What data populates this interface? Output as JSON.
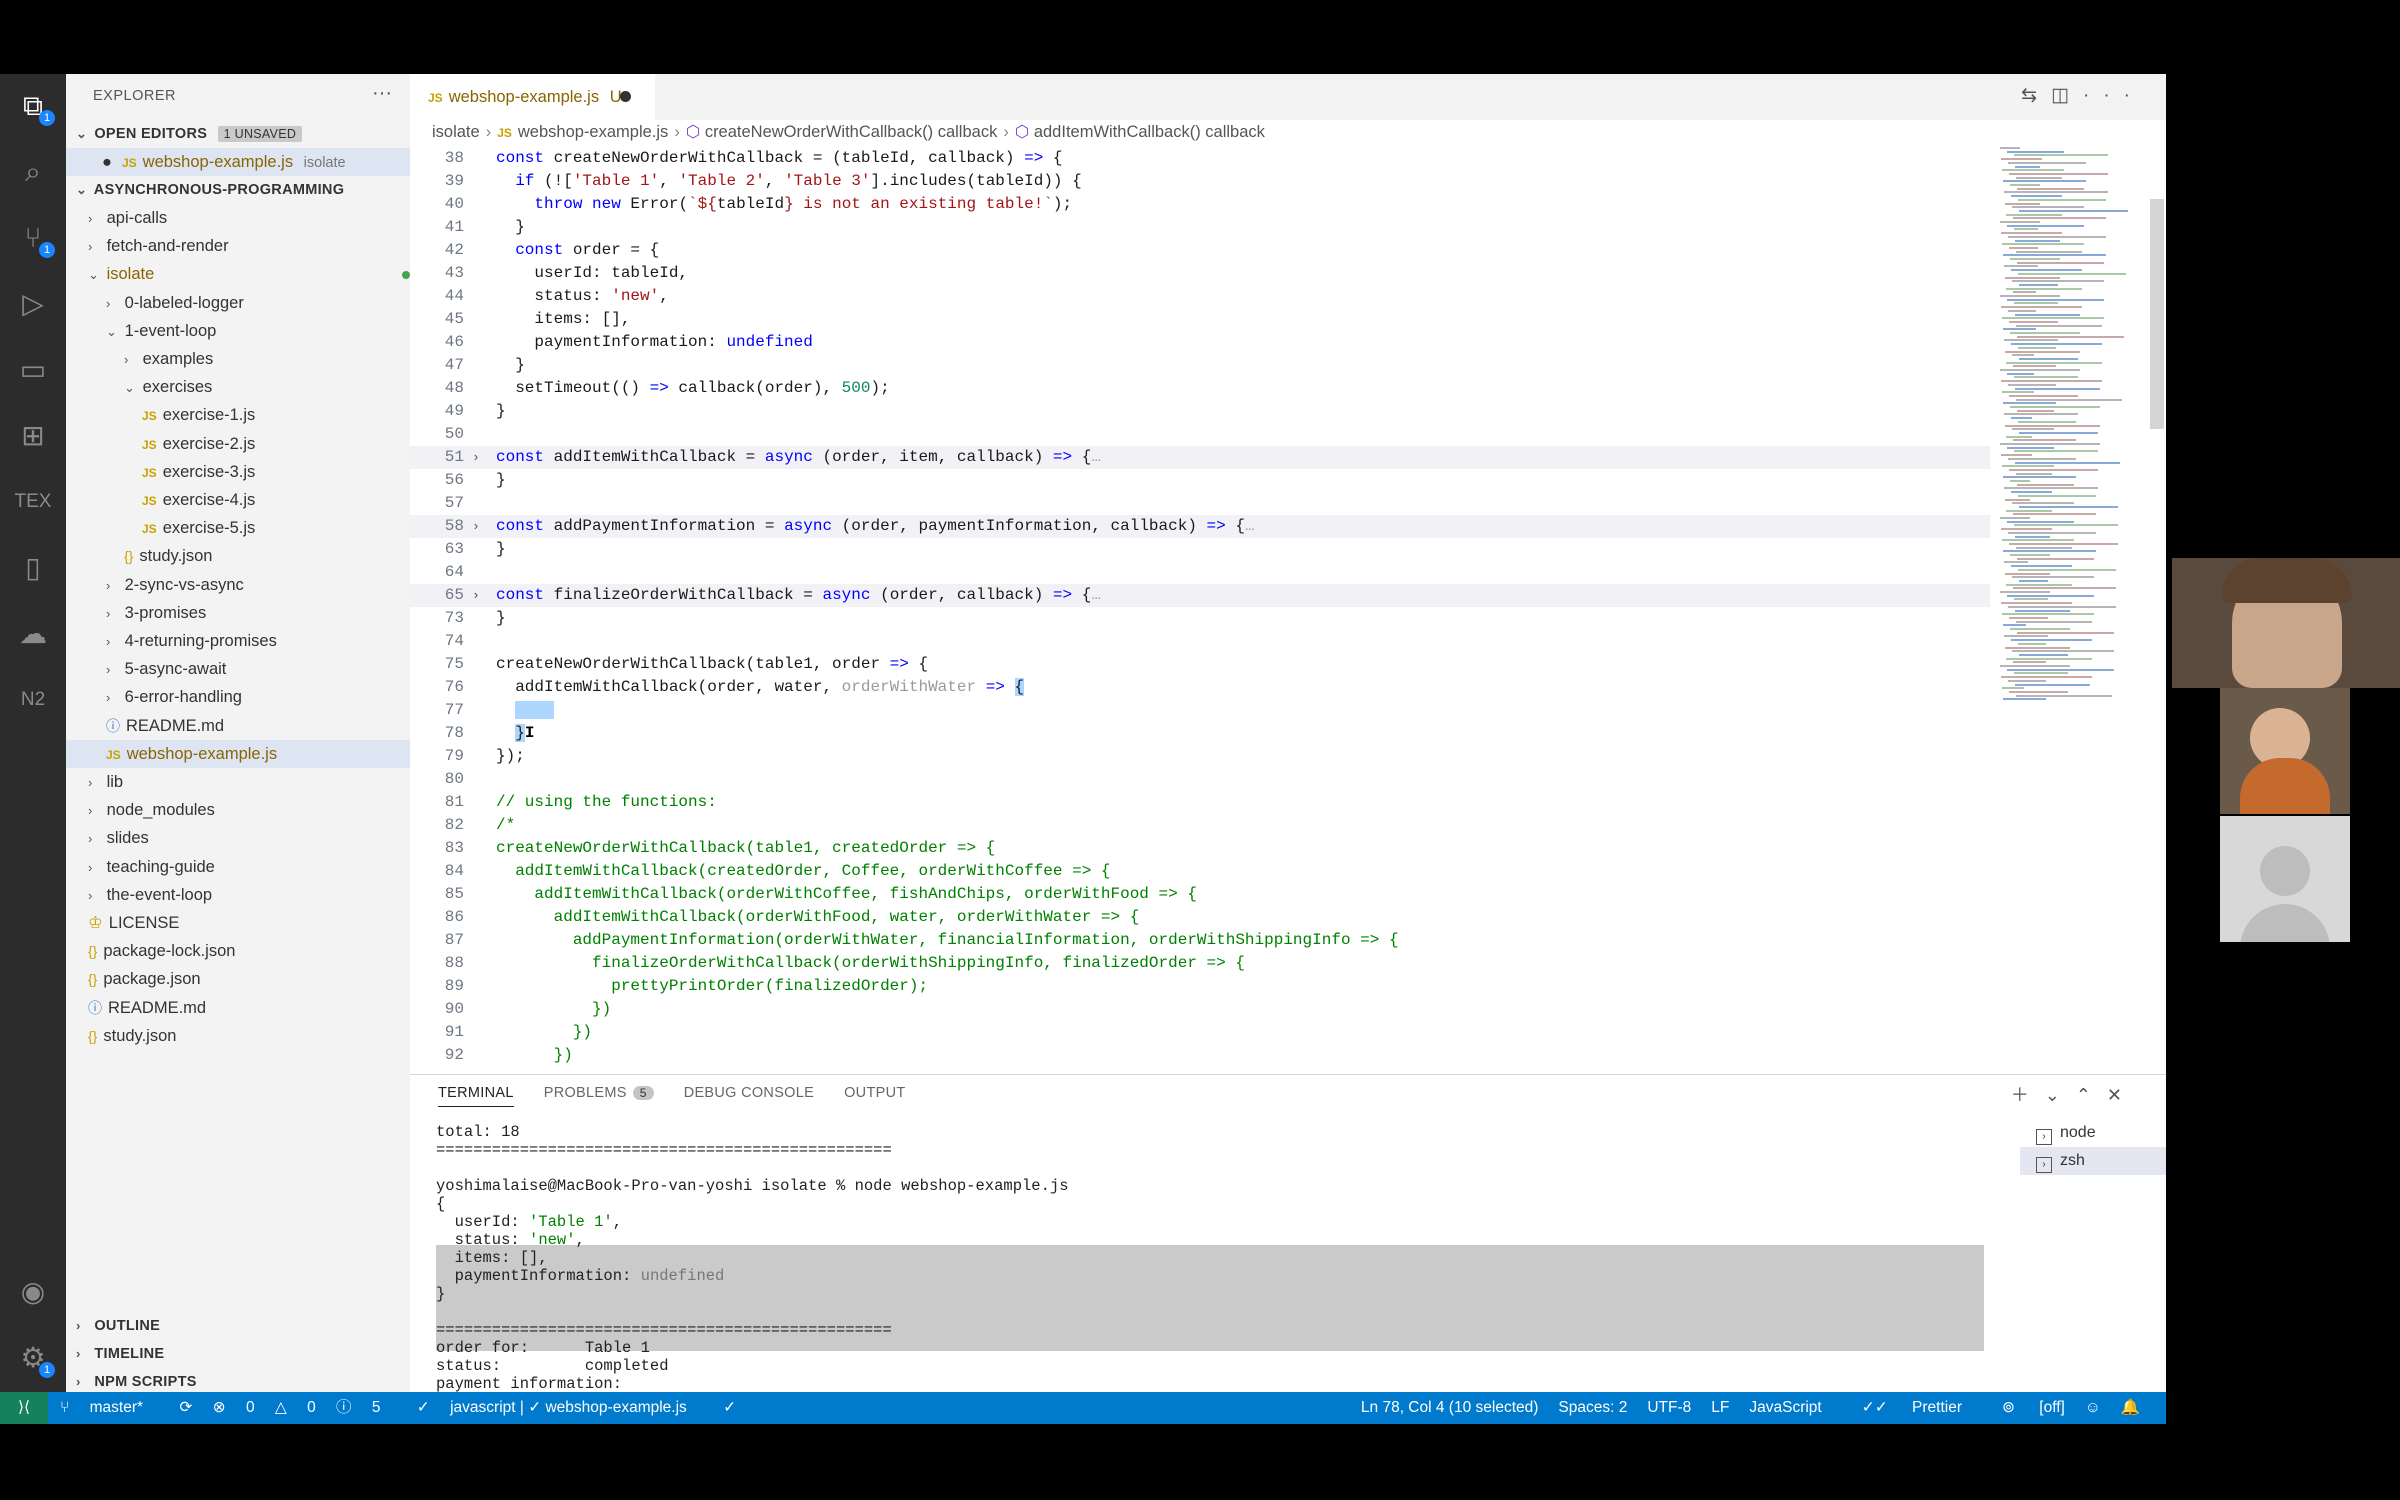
{
  "activity_bar": {
    "icons": [
      "explorer-icon",
      "search-icon",
      "source-control-icon",
      "run-debug-icon",
      "remote-explorer-icon",
      "extensions-icon",
      "tex-icon",
      "bookmark-icon",
      "docker-icon",
      "n2-icon",
      "account-icon",
      "gear-icon"
    ],
    "source_control_badge": "1",
    "explorer_badge": "1",
    "gear_badge": "1",
    "tex_label": "TEX",
    "n2_label": "N2"
  },
  "sidebar": {
    "title": "EXPLORER",
    "open_editors_label": "OPEN EDITORS",
    "unsaved_badge": "1 UNSAVED",
    "open_editor_file": "webshop-example.js",
    "open_editor_folder": "isolate",
    "open_editor_status": "U",
    "project_name": "ASYNCHRONOUS-PROGRAMMING",
    "tree": [
      {
        "label": "api-calls",
        "type": "folder",
        "open": false,
        "indent": 0
      },
      {
        "label": "fetch-and-render",
        "type": "folder",
        "open": false,
        "indent": 0
      },
      {
        "label": "isolate",
        "type": "folder",
        "open": true,
        "indent": 0,
        "modified": true
      },
      {
        "label": "0-labeled-logger",
        "type": "folder",
        "open": false,
        "indent": 1
      },
      {
        "label": "1-event-loop",
        "type": "folder",
        "open": true,
        "indent": 1
      },
      {
        "label": "examples",
        "type": "folder",
        "open": false,
        "indent": 2
      },
      {
        "label": "exercises",
        "type": "folder",
        "open": true,
        "indent": 2
      },
      {
        "label": "exercise-1.js",
        "type": "js",
        "indent": 3
      },
      {
        "label": "exercise-2.js",
        "type": "js",
        "indent": 3
      },
      {
        "label": "exercise-3.js",
        "type": "js",
        "indent": 3
      },
      {
        "label": "exercise-4.js",
        "type": "js",
        "indent": 3
      },
      {
        "label": "exercise-5.js",
        "type": "js",
        "indent": 3
      },
      {
        "label": "study.json",
        "type": "json",
        "indent": 2
      },
      {
        "label": "2-sync-vs-async",
        "type": "folder",
        "open": false,
        "indent": 1
      },
      {
        "label": "3-promises",
        "type": "folder",
        "open": false,
        "indent": 1
      },
      {
        "label": "4-returning-promises",
        "type": "folder",
        "open": false,
        "indent": 1
      },
      {
        "label": "5-async-await",
        "type": "folder",
        "open": false,
        "indent": 1
      },
      {
        "label": "6-error-handling",
        "type": "folder",
        "open": false,
        "indent": 1
      },
      {
        "label": "README.md",
        "type": "info",
        "indent": 1
      },
      {
        "label": "webshop-example.js",
        "type": "js",
        "indent": 1,
        "selected": true,
        "status": "U"
      },
      {
        "label": "lib",
        "type": "folder",
        "open": false,
        "indent": 0
      },
      {
        "label": "node_modules",
        "type": "folder",
        "open": false,
        "indent": 0
      },
      {
        "label": "slides",
        "type": "folder",
        "open": false,
        "indent": 0
      },
      {
        "label": "teaching-guide",
        "type": "folder",
        "open": false,
        "indent": 0
      },
      {
        "label": "the-event-loop",
        "type": "folder",
        "open": false,
        "indent": 0
      },
      {
        "label": "LICENSE",
        "type": "license",
        "indent": 0
      },
      {
        "label": "package-lock.json",
        "type": "json",
        "indent": 0
      },
      {
        "label": "package.json",
        "type": "json",
        "indent": 0
      },
      {
        "label": "README.md",
        "type": "info",
        "indent": 0
      },
      {
        "label": "study.json",
        "type": "json",
        "indent": 0
      }
    ],
    "outline_label": "OUTLINE",
    "timeline_label": "TIMELINE",
    "npm_scripts_label": "NPM SCRIPTS"
  },
  "editor": {
    "tab_label": "webshop-example.js",
    "tab_status": "U",
    "breadcrumb": [
      "isolate",
      "webshop-example.js",
      "createNewOrderWithCallback() callback",
      "addItemWithCallback() callback"
    ],
    "lines": [
      {
        "n": "38",
        "html": "<span class=\"kw\">const</span> createNewOrderWithCallback = (tableId, callback) <span class=\"kw\">=&gt;</span> {"
      },
      {
        "n": "39",
        "html": "  <span class=\"kw\">if</span> (![<span class=\"st\">'Table 1'</span>, <span class=\"st\">'Table 2'</span>, <span class=\"st\">'Table 3'</span>].includes(tableId)) {"
      },
      {
        "n": "40",
        "html": "    <span class=\"kw\">throw new</span> Error(<span class=\"st\">`${</span>tableId<span class=\"st\">} is not an existing table!`</span>);"
      },
      {
        "n": "41",
        "html": "  }"
      },
      {
        "n": "42",
        "html": "  <span class=\"kw\">const</span> order = {"
      },
      {
        "n": "43",
        "html": "    userId: tableId,"
      },
      {
        "n": "44",
        "html": "    status: <span class=\"st\">'new'</span>,"
      },
      {
        "n": "45",
        "html": "    items: [],"
      },
      {
        "n": "46",
        "html": "    paymentInformation: <span class=\"kw\">undefined</span>"
      },
      {
        "n": "47",
        "html": "  }"
      },
      {
        "n": "48",
        "html": "  setTimeout(() <span class=\"kw\">=&gt;</span> callback(order), <span class=\"nm\">500</span>);"
      },
      {
        "n": "49",
        "html": "}"
      },
      {
        "n": "50",
        "html": ""
      },
      {
        "n": "51",
        "fold": true,
        "hl": true,
        "html": "<span class=\"kw\">const</span> addItemWithCallback = <span class=\"kw\">async</span> (order, item, callback) <span class=\"kw\">=&gt;</span> {<span class=\"hint\">…</span>"
      },
      {
        "n": "56",
        "html": "}"
      },
      {
        "n": "57",
        "html": ""
      },
      {
        "n": "58",
        "fold": true,
        "hl": true,
        "html": "<span class=\"kw\">const</span> addPaymentInformation = <span class=\"kw\">async</span> (order, paymentInformation, callback) <span class=\"kw\">=&gt;</span> {<span class=\"hint\">…</span>"
      },
      {
        "n": "63",
        "html": "}"
      },
      {
        "n": "64",
        "html": ""
      },
      {
        "n": "65",
        "fold": true,
        "hl": true,
        "html": "<span class=\"kw\">const</span> finalizeOrderWithCallback = <span class=\"kw\">async</span> (order, callback) <span class=\"kw\">=&gt;</span> {<span class=\"hint\">…</span>"
      },
      {
        "n": "73",
        "html": "}"
      },
      {
        "n": "74",
        "html": ""
      },
      {
        "n": "75",
        "html": "createNewOrderWithCallback(table1, order <span class=\"kw\">=&gt;</span> {"
      },
      {
        "n": "76",
        "html": "  addItemWithCallback(order, water, <span class=\"hint\">orderWithWater</span> <span class=\"kw\">=&gt;</span> <span class=\"sel\">{</span>"
      },
      {
        "n": "77",
        "html": "  <span class=\"sel\">    </span>"
      },
      {
        "n": "78",
        "html": "  <span class=\"sel\">}</span><span class=\"caret-i\">I</span>"
      },
      {
        "n": "79",
        "html": "});"
      },
      {
        "n": "80",
        "html": ""
      },
      {
        "n": "81",
        "html": "<span class=\"cm\">// using the functions:</span>"
      },
      {
        "n": "82",
        "html": "<span class=\"cm\">/*</span>"
      },
      {
        "n": "83",
        "html": "<span class=\"cm\">createNewOrderWithCallback(table1, createdOrder =&gt; {</span>"
      },
      {
        "n": "84",
        "html": "<span class=\"cm\">  addItemWithCallback(createdOrder, Coffee, orderWithCoffee =&gt; {</span>"
      },
      {
        "n": "85",
        "html": "<span class=\"cm\">    addItemWithCallback(orderWithCoffee, fishAndChips, orderWithFood =&gt; {</span>"
      },
      {
        "n": "86",
        "html": "<span class=\"cm\">      addItemWithCallback(orderWithFood, water, orderWithWater =&gt; {</span>"
      },
      {
        "n": "87",
        "html": "<span class=\"cm\">        addPaymentInformation(orderWithWater, financialInformation, orderWithShippingInfo =&gt; {</span>"
      },
      {
        "n": "88",
        "html": "<span class=\"cm\">          finalizeOrderWithCallback(orderWithShippingInfo, finalizedOrder =&gt; {</span>"
      },
      {
        "n": "89",
        "html": "<span class=\"cm\">            prettyPrintOrder(finalizedOrder);</span>"
      },
      {
        "n": "90",
        "html": "<span class=\"cm\">          })</span>"
      },
      {
        "n": "91",
        "html": "<span class=\"cm\">        })</span>"
      },
      {
        "n": "92",
        "html": "<span class=\"cm\">      })</span>"
      }
    ]
  },
  "panel": {
    "tabs": [
      "TERMINAL",
      "PROBLEMS",
      "DEBUG CONSOLE",
      "OUTPUT"
    ],
    "problems_count": "5",
    "terminal_lines": [
      {
        "t": "total: 18",
        "c": ""
      },
      {
        "t": "=================================================",
        "c": ""
      },
      {
        "t": "",
        "c": ""
      },
      {
        "t": "yoshimalaise@MacBook-Pro-van-yoshi isolate % node webshop-example.js",
        "c": ""
      },
      {
        "t": "{",
        "c": ""
      },
      {
        "t": "  userId: <g>'Table 1'</g>,",
        "c": "mix"
      },
      {
        "t": "  status: <g>'new'</g>,",
        "c": "mix"
      },
      {
        "t": "  items: [],",
        "c": ""
      },
      {
        "t": "  paymentInformation: <y>undefined</y>",
        "c": "mix"
      },
      {
        "t": "}",
        "c": ""
      },
      {
        "t": "",
        "c": ""
      },
      {
        "t": "=================================================",
        "c": ""
      },
      {
        "t": "order for:      Table 1",
        "c": ""
      },
      {
        "t": "status:         completed",
        "c": ""
      },
      {
        "t": "payment information:",
        "c": ""
      }
    ],
    "terminal_list": [
      "node",
      "zsh"
    ]
  },
  "status_bar": {
    "branch": "master*",
    "errors": "0",
    "warnings": "0",
    "info": "5",
    "lang_check": "javascript | ✓ webshop-example.js",
    "cursor": "Ln 78, Col 4 (10 selected)",
    "spaces": "Spaces: 2",
    "encoding": "UTF-8",
    "eol": "LF",
    "language": "JavaScript",
    "formatter": "Prettier",
    "off": "[off]"
  },
  "colors": {
    "statusbar": "#007acc",
    "activitybar": "#2c2c2c",
    "sidebar": "#f3f3f3",
    "accent": "#1a85ff"
  }
}
